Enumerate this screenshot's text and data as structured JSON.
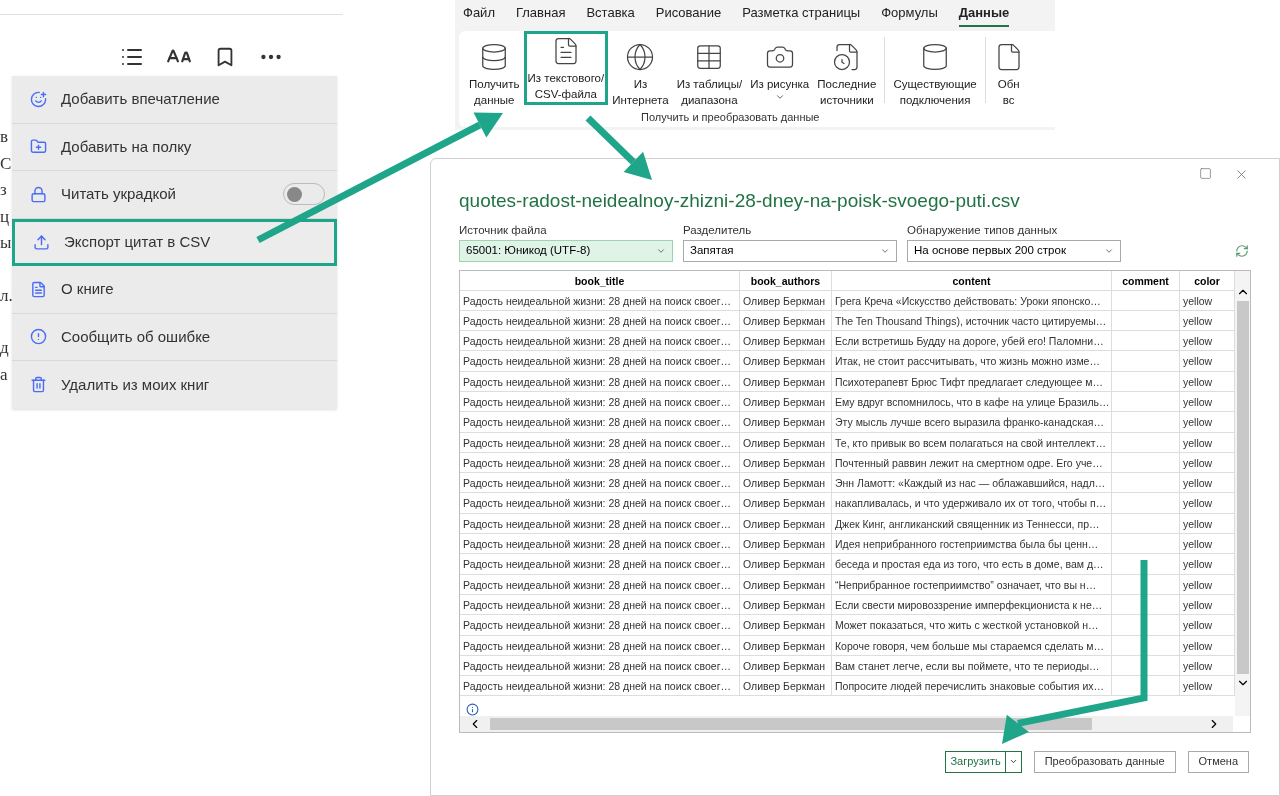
{
  "reader": {
    "paragraphs": [
      [
        "в",
        "С",
        "з",
        "ц",
        "ы"
      ],
      [
        "л."
      ],
      [
        "д",
        "а"
      ]
    ],
    "menu": [
      {
        "label": "Добавить впечатление",
        "kind": "action",
        "highlighted": false
      },
      {
        "label": "Добавить на полку",
        "kind": "action",
        "highlighted": false
      },
      {
        "label": "Читать украдкой",
        "kind": "toggle",
        "on": false,
        "highlighted": false
      },
      {
        "label": "Экспорт цитат в CSV",
        "kind": "action",
        "highlighted": true
      },
      {
        "label": "О книге",
        "kind": "action",
        "highlighted": false
      },
      {
        "label": "Сообщить об ошибке",
        "kind": "action",
        "highlighted": false
      },
      {
        "label": "Удалить из моих книг",
        "kind": "action",
        "highlighted": false
      }
    ]
  },
  "ribbon": {
    "tabs": [
      {
        "label": "Файл",
        "selected": false
      },
      {
        "label": "Главная",
        "selected": false
      },
      {
        "label": "Вставка",
        "selected": false
      },
      {
        "label": "Рисование",
        "selected": false
      },
      {
        "label": "Разметка страницы",
        "selected": false
      },
      {
        "label": "Формулы",
        "selected": false
      },
      {
        "label": "Данные",
        "selected": true
      }
    ],
    "buttons": [
      {
        "lines": [
          "Получить",
          "данные"
        ],
        "highlighted": false,
        "has_menu": false
      },
      {
        "lines": [
          "Из текстового/",
          "CSV-файла"
        ],
        "highlighted": true,
        "has_menu": false
      },
      {
        "lines": [
          "Из",
          "Интернета"
        ],
        "highlighted": false,
        "has_menu": false
      },
      {
        "lines": [
          "Из таблицы/",
          "диапазона"
        ],
        "highlighted": false,
        "has_menu": false
      },
      {
        "lines": [
          "Из рисунка"
        ],
        "highlighted": false,
        "has_menu": true
      },
      {
        "lines": [
          "Последние",
          "источники"
        ],
        "highlighted": false,
        "has_menu": false
      },
      {
        "lines": [
          "Существующие",
          "подключения"
        ],
        "highlighted": false,
        "has_menu": false
      },
      {
        "lines": [
          "Обн",
          "вс"
        ],
        "highlighted": false,
        "has_menu": false
      }
    ],
    "group_label": "Получить и преобразовать данные"
  },
  "dialog": {
    "title": "quotes-radost-neidealnoy-zhizni-28-dney-na-poisk-svoego-puti.csv",
    "fields": [
      {
        "label": "Источник файла",
        "value": "65001: Юникод (UTF-8)",
        "focused": true
      },
      {
        "label": "Разделитель",
        "value": "Запятая",
        "focused": false
      },
      {
        "label": "Обнаружение типов данных",
        "value": "На основе первых 200 строк",
        "focused": false
      }
    ],
    "table": {
      "columns": [
        "book_title",
        "book_authors",
        "content",
        "comment",
        "color"
      ],
      "rows": [
        {
          "book_title": "Радость неидеальной жизни: 28 дней на поиск своег…",
          "book_authors": "Оливер Беркман",
          "content": "Грега Креча «Искусство действовать: Уроки японско…",
          "color_label": "yellow"
        },
        {
          "book_title": "Радость неидеальной жизни: 28 дней на поиск своег…",
          "book_authors": "Оливер Беркман",
          "content": "The Ten Thousand Things), источник часто цитируемы…",
          "color_label": "yellow"
        },
        {
          "book_title": "Радость неидеальной жизни: 28 дней на поиск своег…",
          "book_authors": "Оливер Беркман",
          "content": "Если встретишь Будду на дороге, убей его! Паломни…",
          "color_label": "yellow"
        },
        {
          "book_title": "Радость неидеальной жизни: 28 дней на поиск своег…",
          "book_authors": "Оливер Беркман",
          "content": "Итак, не стоит рассчитывать, что жизнь можно изме…",
          "color_label": "yellow"
        },
        {
          "book_title": "Радость неидеальной жизни: 28 дней на поиск своег…",
          "book_authors": "Оливер Беркман",
          "content": "Психотерапевт Брюс Тифт предлагает следующее м…",
          "color_label": "yellow"
        },
        {
          "book_title": "Радость неидеальной жизни: 28 дней на поиск своег…",
          "book_authors": "Оливер Беркман",
          "content": "Ему вдруг вспомнилось, что в кафе на улице Бразиль…",
          "color_label": "yellow"
        },
        {
          "book_title": "Радость неидеальной жизни: 28 дней на поиск своег…",
          "book_authors": "Оливер Беркман",
          "content": "Эту мысль лучше всего выразила франко-канадская…",
          "color_label": "yellow"
        },
        {
          "book_title": "Радость неидеальной жизни: 28 дней на поиск своег…",
          "book_authors": "Оливер Беркман",
          "content": "Те, кто привык во всем полагаться на свой интеллект…",
          "color_label": "yellow"
        },
        {
          "book_title": "Радость неидеальной жизни: 28 дней на поиск своег…",
          "book_authors": "Оливер Беркман",
          "content": "Почтенный раввин лежит на смертном одре. Его уче…",
          "color_label": "yellow"
        },
        {
          "book_title": "Радость неидеальной жизни: 28 дней на поиск своег…",
          "book_authors": "Оливер Беркман",
          "content": "Энн Ламотт: «Каждый из нас — облажавшийся, надл…",
          "color_label": "yellow"
        },
        {
          "book_title": "Радость неидеальной жизни: 28 дней на поиск своег…",
          "book_authors": "Оливер Беркман",
          "content": "накапливалась, и что удерживало их от того, чтобы п…",
          "color_label": "yellow"
        },
        {
          "book_title": "Радость неидеальной жизни: 28 дней на поиск своег…",
          "book_authors": "Оливер Беркман",
          "content": "Джек Кинг, англиканский священник из Теннесси, пр…",
          "color_label": "yellow"
        },
        {
          "book_title": "Радость неидеальной жизни: 28 дней на поиск своег…",
          "book_authors": "Оливер Беркман",
          "content": "Идея неприбранного гостеприимства была бы ценн…",
          "color_label": "yellow"
        },
        {
          "book_title": "Радость неидеальной жизни: 28 дней на поиск своег…",
          "book_authors": "Оливер Беркман",
          "content": "беседа и простая еда из того, что есть в доме, вам д…",
          "color_label": "yellow"
        },
        {
          "book_title": "Радость неидеальной жизни: 28 дней на поиск своег…",
          "book_authors": "Оливер Беркман",
          "content": "“Неприбранное гостеприимство” означает, что вы н…",
          "color_label": "yellow"
        },
        {
          "book_title": "Радость неидеальной жизни: 28 дней на поиск своег…",
          "book_authors": "Оливер Беркман",
          "content": "Если свести мировоззрение имперфекциониста к не…",
          "color_label": "yellow"
        },
        {
          "book_title": "Радость неидеальной жизни: 28 дней на поиск своег…",
          "book_authors": "Оливер Беркман",
          "content": "Может показаться, что жить с жесткой установкой н…",
          "color_label": "yellow"
        },
        {
          "book_title": "Радость неидеальной жизни: 28 дней на поиск своег…",
          "book_authors": "Оливер Беркман",
          "content": "Короче говоря, чем больше мы стараемся сделать м…",
          "color_label": "yellow"
        },
        {
          "book_title": "Радость неидеальной жизни: 28 дней на поиск своег…",
          "book_authors": "Оливер Беркман",
          "content": "Вам станет легче, если вы поймете, что те периоды…",
          "color_label": "yellow"
        },
        {
          "book_title": "Радость неидеальной жизни: 28 дней на поиск своег…",
          "book_authors": "Оливер Беркман",
          "content": "Попросите людей перечислить знаковые события их…",
          "color_label": "yellow"
        }
      ]
    },
    "buttons": [
      {
        "label": "Загрузить",
        "kind": "split",
        "primary": true
      },
      {
        "label": "Преобразовать данные",
        "kind": "plain",
        "primary": false
      },
      {
        "label": "Отмена",
        "kind": "plain",
        "primary": false
      }
    ]
  }
}
